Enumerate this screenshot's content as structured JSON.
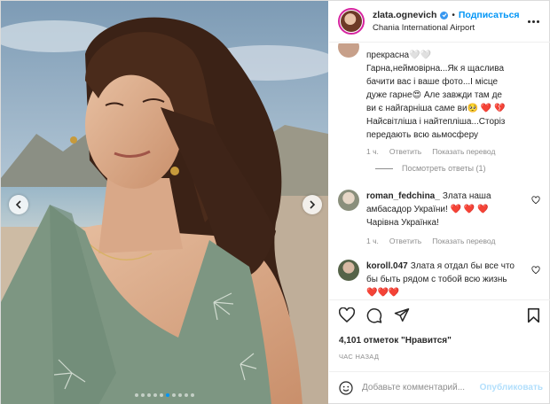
{
  "post": {
    "username": "zlata.ognevich",
    "separator": "•",
    "follow_label": "Подписаться",
    "location": "Chania International Airport"
  },
  "photo": {
    "total_slides": 10,
    "active_slide": 6
  },
  "comments": {
    "first": {
      "line1": "прекрасна🤍🤍",
      "line2": "Гарна,неймовірна...Як я щаслива",
      "line3": "бачити вас і ваше фото...І місце",
      "line4": "дуже гарне😍 Але завжди там де",
      "line5": "ви є найгарніша саме ви🥺 ❤️ 💔",
      "line6": "Найсвітліша і найтепліша...Сторіз",
      "line7": "передають всю аьмосферу",
      "time": "1 ч.",
      "reply": "Ответить",
      "translate": "Показать перевод"
    },
    "view_replies": "Посмотреть ответы (1)",
    "second": {
      "username": "roman_fedchina_",
      "line1": "Злата наша",
      "line2": "амбасадор України! ❤️ ❤️ ❤️",
      "line3": "Чарівна Українка!",
      "time": "1 ч.",
      "reply": "Ответить",
      "translate": "Показать перевод"
    },
    "third": {
      "username": "koroll.047",
      "line1": "Злата я отдал бы все что",
      "line2": "бы быть рядом с тобой всю жизнь",
      "line3": "❤️❤️❤️"
    }
  },
  "actions": {
    "likes": "4,101 отметок \"Нравится\"",
    "time": "Час назад"
  },
  "add_comment": {
    "placeholder": "Добавьте комментарий...",
    "publish": "Опубликовать"
  },
  "colors": {
    "accent": "#0095f6",
    "publish_disabled": "#b2dffc",
    "muted": "#8e8e8e"
  }
}
